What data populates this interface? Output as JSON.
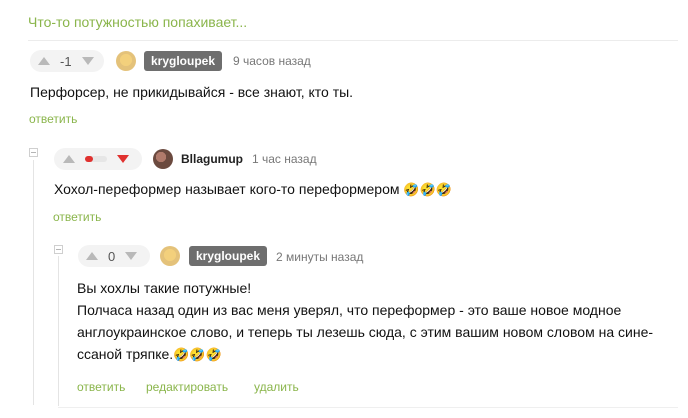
{
  "post_title": "Что-то потужностью попахивает...",
  "emoji": "🤣🤣🤣",
  "comments": [
    {
      "rating": "-1",
      "author": "krygloupek",
      "time": "9 часов назад",
      "text": "Перфорсер, не прикидывайся - все знают, кто ты.",
      "actions": [
        "ответить"
      ]
    },
    {
      "rating_dir": "down",
      "author": "Bllagumup",
      "time": "1 час назад",
      "text": "Хохол-переформер называет кого-то переформером",
      "actions": [
        "ответить"
      ]
    },
    {
      "rating": "0",
      "author": "krygloupek",
      "time": "2 минуты назад",
      "line1": "Вы хохлы такие потужные!",
      "line2": "Полчаса назад один из вас меня уверял, что переформер - это ваше новое модное",
      "line3": "англоукраинское слово, и теперь ты лезешь сюда, с этим вашим новом словом на сине-",
      "line4": "ссаной тряпке.",
      "actions": [
        "ответить",
        "редактировать",
        "удалить"
      ]
    }
  ]
}
